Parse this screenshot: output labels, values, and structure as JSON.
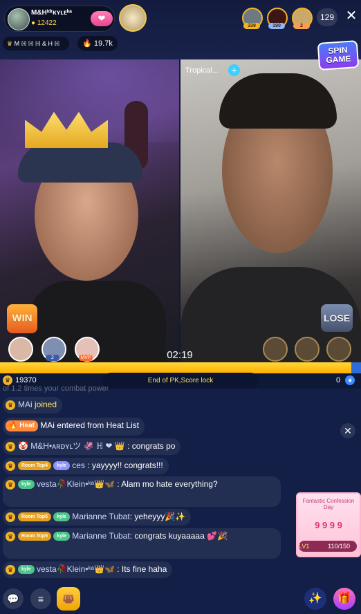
{
  "host": {
    "name": "M&Hᴵᵈʳᴋʏʟᴇᵏᵃ",
    "coins": "12422",
    "follow_icon": "❤"
  },
  "viewers": {
    "badges": [
      "339",
      "190",
      "2"
    ],
    "count": "129"
  },
  "close_icon": "✕",
  "family_tag": "M ℍ ℍ ℍ & H ℍ",
  "heat": {
    "icon": "🔥",
    "value": "19.7k"
  },
  "spin_game": {
    "line1": "SPIN",
    "line2": "GAME"
  },
  "right_stream_title": "Tropical...",
  "plus_symbol": "+",
  "pk": {
    "left_result": "WIN",
    "right_result": "LOSE",
    "timer": "02:19",
    "left_supporter_labels": [
      "",
      "2",
      "MVP"
    ],
    "left_score": "19370",
    "right_score": "0",
    "status": "End of PK,Score lock"
  },
  "chat": {
    "partial_line": "of 1.2 times your combat power",
    "messages": [
      {
        "prefix": "MAi",
        "text": " joined"
      },
      {
        "badge": "Heat",
        "text": "MAi entered from Heat List"
      },
      {
        "name": "🤡 M&H•ᴀʀᴅʏʟツ 🦑 ℍ ❤ 👑",
        "text": " : congrats po"
      },
      {
        "badge": "Room Top4",
        "sub_badge": "kyle",
        "name": "ces",
        "text": ": yayyyy!! congrats!!!"
      },
      {
        "sub_badge": "kyle",
        "name": "vesta🥀Klein•ᵏᵃ👑🦋",
        "text": " : Alam mo hate everything?"
      },
      {
        "badge": "Room Top5",
        "sub_badge": "kyle",
        "name": "Marianne Tubat",
        "text": ": yeheyyy🎉✨"
      },
      {
        "badge": "Room Top5",
        "sub_badge": "kyle",
        "name": "Marianne Tubat",
        "text": ": congrats kuyaaaaa 💕🎉"
      },
      {
        "sub_badge": "kyle",
        "name": "vesta🥀Klein•ᵏᵃ👑🦋",
        "text": " : Its fine haha"
      }
    ]
  },
  "promo": {
    "title": "Fantastic Confession Day",
    "numbers": "9 9 9 9",
    "level": "LV1",
    "progress": "110/150"
  },
  "bottom": {
    "chat_icon": "💬",
    "menu_icon": "≡",
    "bag_icon": "👜",
    "wand_icon": "✨",
    "gift_icon": "🎁"
  },
  "colors": {
    "accent_yellow": "#ffd53a",
    "accent_blue": "#2f6cd8",
    "chat_bg": "#131f46"
  }
}
